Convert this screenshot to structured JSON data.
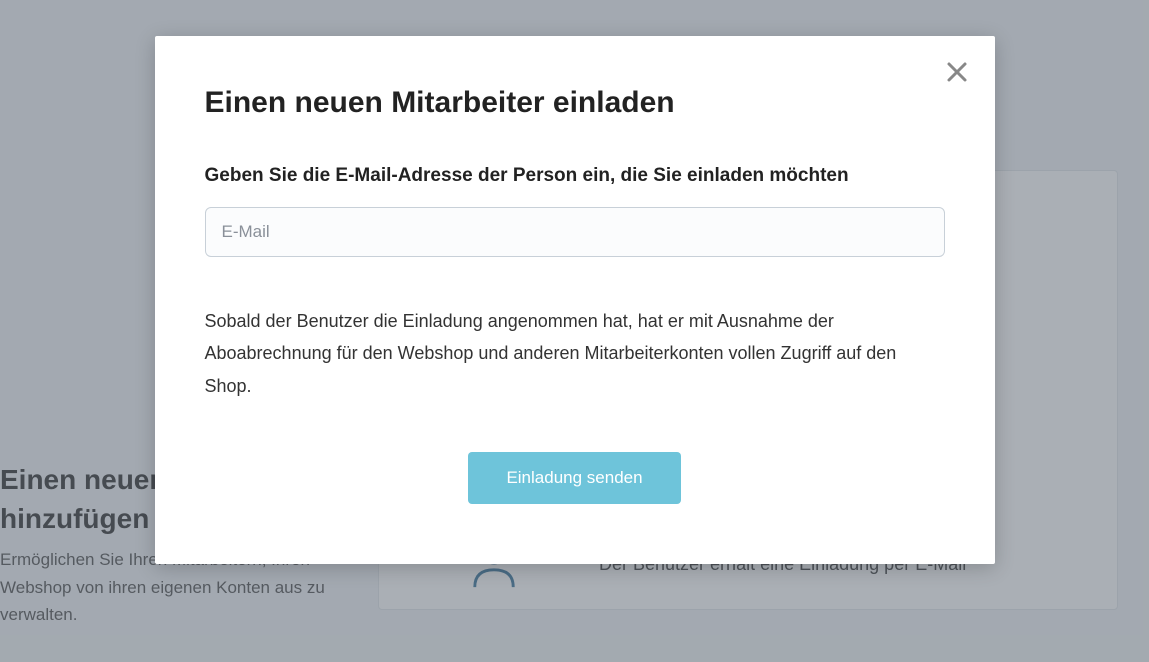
{
  "background": {
    "sidebar": {
      "heading": "Einen neuen Mitarbeiter hinzufügen",
      "description": "Ermöglichen Sie Ihren Mitarbeitern, Ihren Webshop von ihren eigenen Konten aus zu verwalten."
    },
    "card": {
      "row_text": "Der Benutzer erhält eine Einladung per E-Mail"
    }
  },
  "modal": {
    "title": "Einen neuen Mitarbeiter einladen",
    "subtitle": "Geben Sie die E-Mail-Adresse der Person ein, die Sie einladen möchten",
    "email_placeholder": "E-Mail",
    "info_text": "Sobald der Benutzer die Einladung angenommen hat, hat er mit Ausnahme der Aboabrechnung für den Webshop und anderen Mitarbeiterkonten vollen Zugriff auf den Shop.",
    "send_button": "Einladung senden"
  }
}
